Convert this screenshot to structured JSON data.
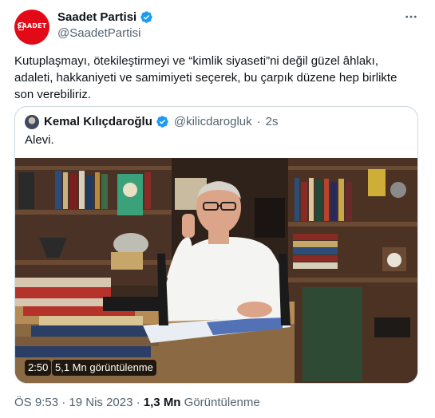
{
  "author": {
    "display_name": "Saadet Partisi",
    "handle": "@SaadetPartisi",
    "avatar_logo_text": "SAADET",
    "verified": true
  },
  "more_icon": "more-horizontal-icon",
  "tweet": {
    "line1": "Kutuplaşmayı, ötekileştirmeyi ve “kimlik siyaseti”ni değil güzel âhlakı,",
    "line2": "adaleti, hakkaniyeti ve samimiyeti seçerek, bu çarpık düzene hep birlikte",
    "line3": "son verebiliriz."
  },
  "quote": {
    "display_name": "Kemal Kılıçdaroğlu",
    "handle": "@kilicdarogluk",
    "separator": "·",
    "time": "2s",
    "text": "Alevi.",
    "verified": true
  },
  "video": {
    "duration": "2:50",
    "views": "5,1 Mn görüntülenme"
  },
  "footer": {
    "time": "ÖS 9:53",
    "sep1": "·",
    "date": "19 Nis 2023",
    "sep2": "·",
    "views_count": "1,3 Mn",
    "views_label": "Görüntülenme"
  },
  "colors": {
    "verified_blue": "#1d9bf0",
    "brand_red": "#e30a17",
    "secondary_text": "#536471"
  }
}
